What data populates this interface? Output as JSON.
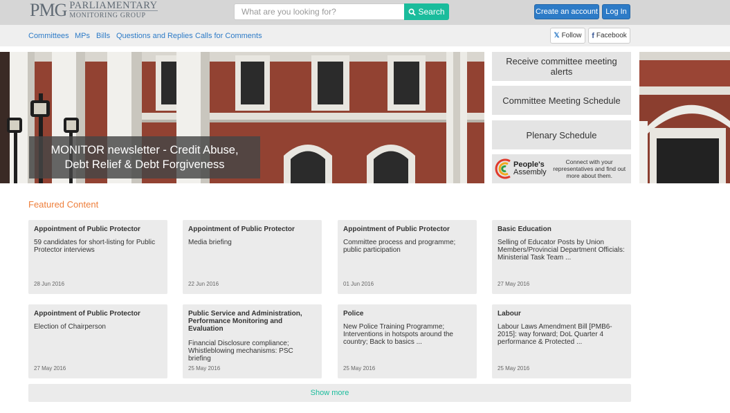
{
  "header": {
    "logo_mark": "PMG",
    "logo_line1": "PARLIAMENTARY",
    "logo_line2": "MONITORING GROUP",
    "search_placeholder": "What are you looking for?",
    "search_label": "Search",
    "create_account_label": "Create an account",
    "login_label": "Log In"
  },
  "nav": {
    "links": [
      "Committees",
      "MPs",
      "Bills",
      "Questions and Replies",
      "Calls for Comments"
    ],
    "follow_label": "Follow",
    "facebook_label": "Facebook"
  },
  "hero": {
    "newsletter_line1": "MONITOR newsletter - Credit Abuse,",
    "newsletter_line2": "Debt Relief & Debt Forgiveness"
  },
  "side": {
    "alerts": "Receive committee meeting alerts",
    "schedule": "Committee Meeting Schedule",
    "plenary": "Plenary Schedule",
    "pa_name1": "People's",
    "pa_name2": "Assembly",
    "pa_text": "Connect with your representatives and find out more about them."
  },
  "featured": {
    "title": "Featured Content",
    "cards": [
      {
        "category": "Appointment of Public Protector",
        "description": "59 candidates for short-listing for Public Protector interviews",
        "date": "28 Jun 2016"
      },
      {
        "category": "Appointment of Public Protector",
        "description": "Media briefing",
        "date": "22 Jun 2016"
      },
      {
        "category": "Appointment of Public Protector",
        "description": "Committee process and programme; public participation",
        "date": "01 Jun 2016"
      },
      {
        "category": "Basic Education",
        "description": "Selling of Educator Posts by Union Members/Provincial Department Officials: Ministerial Task Team ...",
        "date": "27 May 2016"
      },
      {
        "category": "Appointment of Public Protector",
        "description": "Election of Chairperson",
        "date": "27 May 2016"
      },
      {
        "category": "Public Service and Administration, Performance Monitoring and Evaluation",
        "description": "Financial Disclosure compliance; Whistleblowing mechanisms: PSC briefing",
        "date": "25 May 2016"
      },
      {
        "category": "Police",
        "description": "New Police Training Programme; Interventions in hotspots around the country; Back to basics ...",
        "date": "25 May 2016"
      },
      {
        "category": "Labour",
        "description": "Labour Laws Amendment Bill [PMB6-2015]: way forward; DoL Quarter 4 performance & Protected ...",
        "date": "25 May 2016"
      }
    ],
    "show_more": "Show more"
  },
  "colors": {
    "accent": "#1abc9c",
    "primary_blue": "#2d7bc7",
    "featured_orange": "#ee7e3a"
  },
  "icons": {
    "search": "search-icon",
    "twitter": "twitter-icon",
    "facebook": "facebook-icon"
  }
}
